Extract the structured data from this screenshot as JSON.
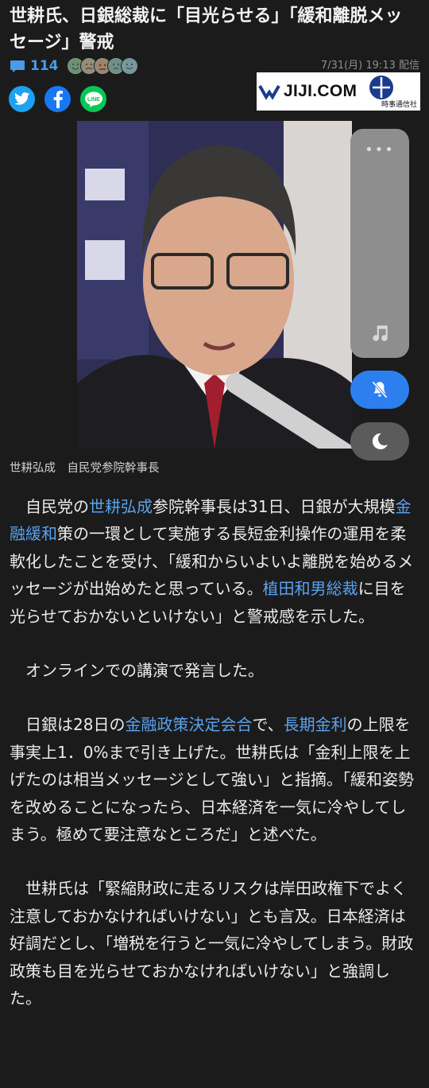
{
  "article": {
    "title": "世耕氏、日銀総裁に「目光らせる」「緩和離脱メッセージ」警戒",
    "comment_count": "114",
    "pubdate": "7/31(月) 19:13 配信",
    "source_logo_text": "JIJI.COM",
    "source_logo_sub": "時事通信社",
    "photo_caption": "世耕弘成　自民党参院幹事長",
    "p1": {
      "s1": "　自民党の",
      "l1": "世耕弘成",
      "s2": "参院幹事長は31日、日銀が大規模",
      "l2": "金融緩和",
      "s3": "策の一環として実施する長短金利操作の運用を柔軟化したことを受け、「緩和からいよいよ離脱を始めるメッセージが出始めたと思っている。",
      "l3": "植田和男総裁",
      "s4": "に目を光らせておかないといけない」と警戒感を示した。"
    },
    "p2": "　オンラインでの講演で発言した。",
    "p3": {
      "s1": "　日銀は28日の",
      "l1": "金融政策決定会合",
      "s2": "で、",
      "l2": "長期金利",
      "s3": "の上限を事実上1．0%まで引き上げた。世耕氏は「金利上限を上げたのは相当メッセージとして強い」と指摘。「緩和姿勢を改めることになったら、日本経済を一気に冷やしてしまう。極めて要注意なところだ」と述べた。"
    },
    "p4": "　世耕氏は「緊縮財政に走るリスクは岸田政権下でよく注意しておかなければいけない」とも言及。日本経済は好調だとし、「増税を行うと一気に冷やしてしまう。財政政策も目を光らせておかなければいけない」と強調した。"
  },
  "icons": {
    "comment": "comment-icon",
    "share": [
      "twitter-icon",
      "facebook-icon",
      "line-icon"
    ],
    "panel": [
      "more-dots-icon",
      "music-icon",
      "mute-bell-icon",
      "moon-icon"
    ]
  },
  "colors": {
    "background": "#1b1b1b",
    "link": "#5aa2f0",
    "accent_blue": "#2d7ff0"
  }
}
